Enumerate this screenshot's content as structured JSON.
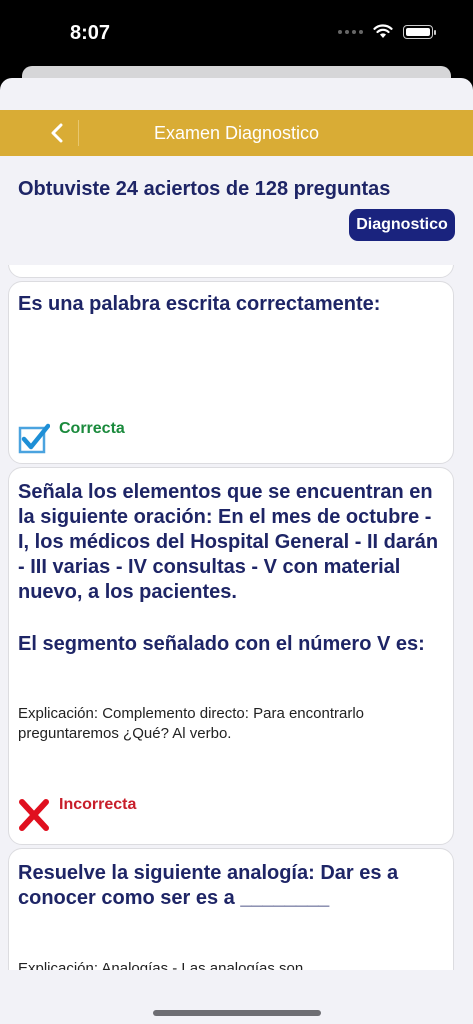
{
  "status_bar": {
    "time": "8:07"
  },
  "nav": {
    "title": "Examen Diagnostico"
  },
  "header": {
    "score": "Obtuviste 24 aciertos de 128 preguntas",
    "badge": "Diagnostico"
  },
  "questions": [
    {
      "text": "Es una palabra escrita correctamente:",
      "status": "Correcta",
      "icon": "checkbox-checked-icon"
    },
    {
      "text": "Señala los elementos que se encuentran en la siguiente oración: En el mes de octubre - I, los médicos del Hospital General - II darán - III varias - IV consultas - V con material nuevo, a los pacientes.",
      "subtext": "El segmento señalado con el número V es:",
      "explanation": "Explicación: Complemento directo: Para encontrarlo preguntaremos ¿Qué? Al verbo.",
      "status": "Incorrecta",
      "icon": "x-mark-icon"
    },
    {
      "text": "Resuelve la siguiente analogía: Dar es a conocer como ser es a ________",
      "explanation": "Explicación: Analogías.- Las analogías son"
    }
  ],
  "colors": {
    "nav": "#d9ac35",
    "title": "#1e2566",
    "badge": "#1a237e",
    "correct": "#1a8a3c",
    "incorrect": "#c81e2a"
  }
}
